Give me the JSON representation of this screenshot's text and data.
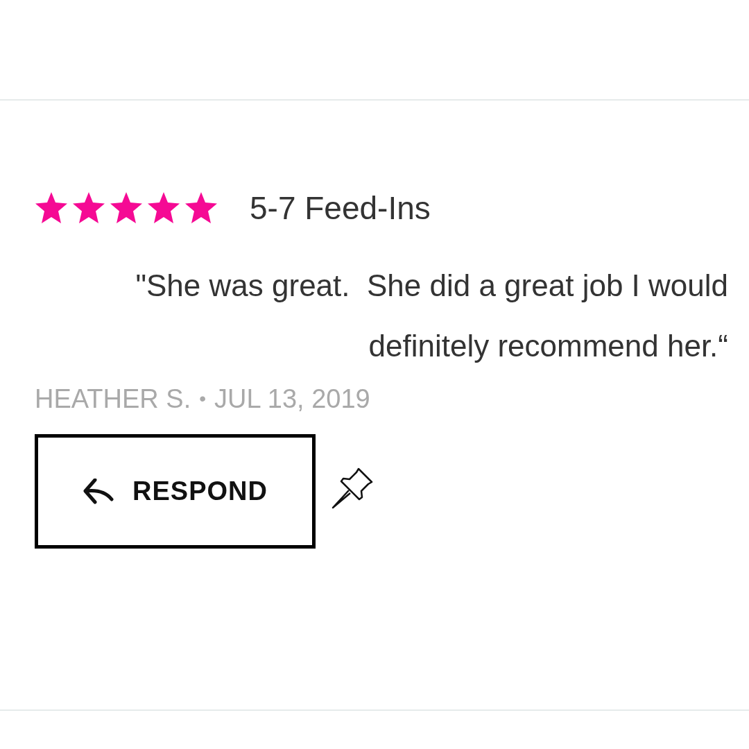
{
  "review": {
    "stars": 5,
    "title": "5-7 Feed-Ins",
    "quote": "\"She was great.  She did a great job I would definitely recommend her.“",
    "author": "HEATHER S.",
    "separator": "•",
    "date": "JUL 13, 2019",
    "respond_button": "RESPOND"
  }
}
